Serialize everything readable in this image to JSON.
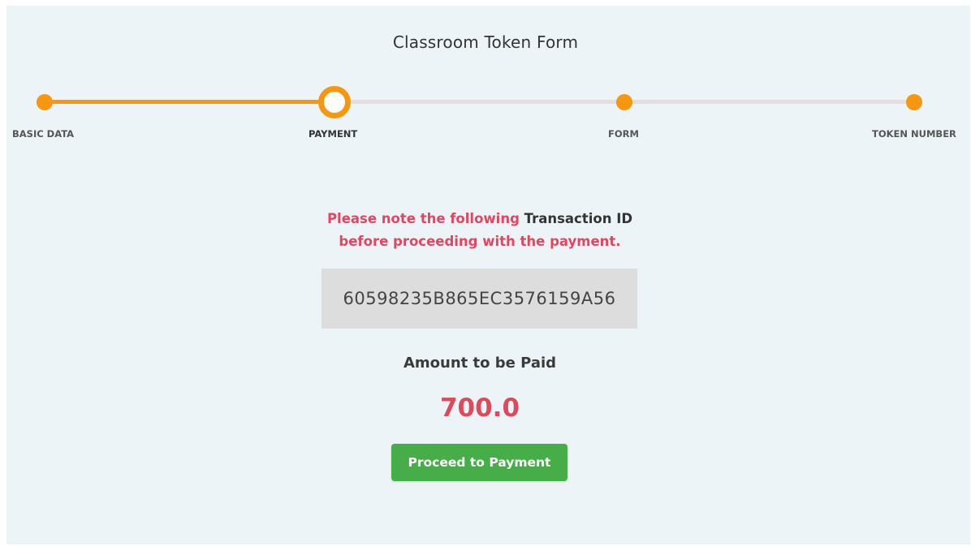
{
  "form": {
    "title": "Classroom Token Form"
  },
  "stepper": {
    "steps": [
      {
        "label": "BASIC DATA",
        "state": "completed"
      },
      {
        "label": "PAYMENT",
        "state": "current"
      },
      {
        "label": "FORM",
        "state": "upcoming"
      },
      {
        "label": "TOKEN NUMBER",
        "state": "upcoming"
      }
    ],
    "colors": {
      "accent": "#f7960f",
      "track_inactive": "#e6dedb"
    }
  },
  "payment": {
    "notice_part1": "Please note the following",
    "notice_highlight": "Transaction ID",
    "notice_part2": "before proceeding with the payment.",
    "transaction_id": "60598235B865EC3576159A56",
    "amount_label": "Amount to be Paid",
    "amount_value": "700.0",
    "proceed_button_label": "Proceed to Payment"
  },
  "colors": {
    "notice": "#e5465e",
    "amount": "#dc4a5c",
    "button": "#46ad49",
    "background": "#edf4f8"
  }
}
